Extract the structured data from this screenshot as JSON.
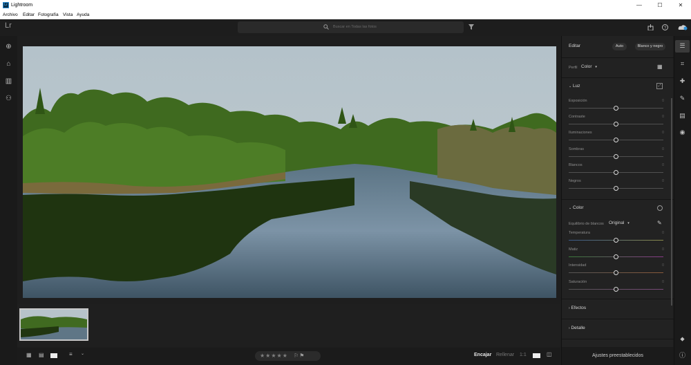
{
  "window": {
    "title": "Lightroom",
    "logo_text": "Lr",
    "min": "—",
    "max": "☐",
    "close": "✕"
  },
  "menu": [
    "Archivo",
    "Editar",
    "Fotografía",
    "Vista",
    "Ayuda"
  ],
  "app_logo": "Lr",
  "search": {
    "placeholder": "Buscar en Todas las fotos"
  },
  "edit_panel": {
    "title": "Editar",
    "auto_label": "Auto",
    "bw_label": "Blanco y negro",
    "profile_label": "Perfil",
    "profile_value": "Color",
    "light": {
      "title": "Luz",
      "sliders": [
        {
          "label": "Exposición",
          "value": "0"
        },
        {
          "label": "Contraste",
          "value": "0"
        },
        {
          "label": "Iluminaciones",
          "value": "0"
        },
        {
          "label": "Sombras",
          "value": "0"
        },
        {
          "label": "Blancos",
          "value": "0"
        },
        {
          "label": "Negros",
          "value": "0"
        }
      ]
    },
    "color": {
      "title": "Color",
      "wb_label": "Equilibrio de blancos",
      "wb_value": "Original",
      "sliders": [
        {
          "label": "Temperatura",
          "value": "0"
        },
        {
          "label": "Matiz",
          "value": "0"
        },
        {
          "label": "Intensidad",
          "value": "0"
        },
        {
          "label": "Saturación",
          "value": "0"
        }
      ]
    },
    "effects_title": "Efectos",
    "detail_title": "Detalle",
    "presets_label": "Ajustes preestablecidos"
  },
  "bottom": {
    "fit_label": "Encajar",
    "fill_label": "Rellenar",
    "one_to_one_label": "1:1",
    "stars": "★★★★★"
  },
  "colors": {
    "accent": "#2d8fd6",
    "panel": "#222222",
    "background": "#1e1e1e"
  }
}
